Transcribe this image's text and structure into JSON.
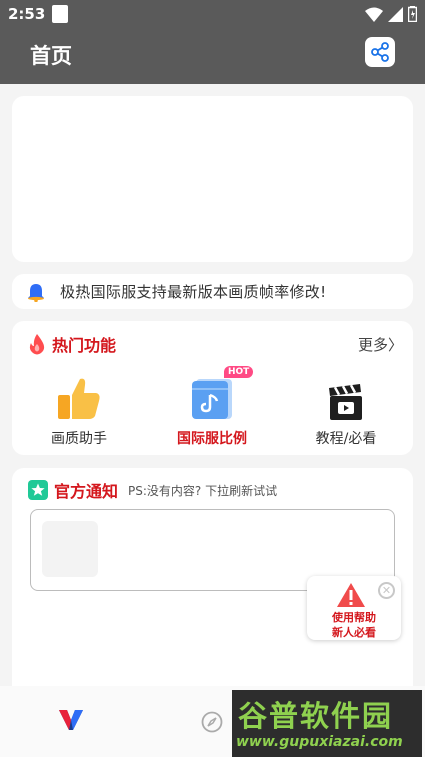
{
  "status_bar": {
    "time": "2:53"
  },
  "header": {
    "title": "首页"
  },
  "notice_bar": {
    "text": "极热国际服支持最新版本画质帧率修改!"
  },
  "hot_features": {
    "title": "热门功能",
    "more": "更多〉",
    "items": [
      {
        "label": "画质助手",
        "icon": "thumbs-up-icon",
        "highlight": false
      },
      {
        "label": "国际服比例",
        "icon": "aspect-ratio-icon",
        "badge": "HOT",
        "highlight": true
      },
      {
        "label": "教程/必看",
        "icon": "clapperboard-icon",
        "highlight": false
      }
    ]
  },
  "official_notice": {
    "title": "官方通知",
    "hint": "PS:没有内容? 下拉刷新试试"
  },
  "help_popup": {
    "line1": "使用帮助",
    "line2": "新人必看"
  },
  "watermark": {
    "brand": "谷普软件园",
    "url": "www.gupuxiazai.com"
  },
  "colors": {
    "accent_red": "#d4171d",
    "header_bg": "#5a5a5a",
    "hot_badge": "#ff4a84"
  }
}
